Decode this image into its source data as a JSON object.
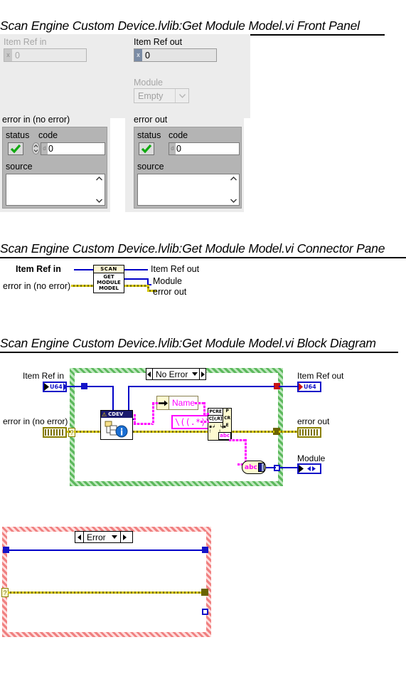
{
  "sections": {
    "front_panel_title": "Scan Engine Custom Device.lvlib:Get Module Model.vi Front Panel",
    "connector_pane_title": "Scan Engine Custom Device.lvlib:Get Module Model.vi Connector Pane",
    "block_diagram_title": "Scan Engine Custom Device.lvlib:Get Module Model.vi Block Diagram"
  },
  "front_panel": {
    "item_ref_in": {
      "label": "Item Ref in",
      "value": "0",
      "type_chip": "x",
      "enabled": false
    },
    "item_ref_out": {
      "label": "Item Ref out",
      "value": "0",
      "type_chip": "x",
      "enabled": true
    },
    "module": {
      "label": "Module",
      "value": "Empty",
      "enabled": false
    },
    "error_in": {
      "label": "error in (no error)",
      "status_label": "status",
      "code_label": "code",
      "code_value": "0",
      "code_chip": "d",
      "source_label": "source",
      "source_value": ""
    },
    "error_out": {
      "label": "error out",
      "status_label": "status",
      "code_label": "code",
      "code_value": "0",
      "code_chip": "d",
      "source_label": "source",
      "source_value": ""
    }
  },
  "connector_pane": {
    "icon": {
      "banner": "SCAN",
      "line1": "GET",
      "line2": "MODULE",
      "line3": "MODEL"
    },
    "inputs": [
      {
        "label": "Item Ref in",
        "bold": true
      },
      {
        "label": "error in (no error)",
        "bold": false
      }
    ],
    "outputs": [
      {
        "label": "Item Ref out"
      },
      {
        "label": "Module"
      },
      {
        "label": "error out"
      }
    ]
  },
  "block_diagram": {
    "case_no_error": {
      "selector": "No Error",
      "terminals": {
        "item_ref_in": {
          "label": "Item Ref in",
          "type": "U64"
        },
        "item_ref_out": {
          "label": "Item Ref out",
          "type": "U64"
        },
        "error_in": {
          "label": "error in (no error)"
        },
        "error_out": {
          "label": "error out"
        },
        "module": {
          "label": "Module"
        }
      },
      "nodes": {
        "cdev_property": {
          "class": "CDEV",
          "kind": "property-node"
        },
        "name_property": {
          "label": "Name"
        },
        "regex_constant": {
          "value": "\\((.*)\\)"
        },
        "pcre_match": {
          "line1": "PCRE",
          "line2": "C[r,R]",
          "side": "PCRE",
          "out": "abc"
        },
        "scan_from_string": {
          "label": "abc"
        }
      }
    },
    "case_error": {
      "selector": "Error"
    }
  },
  "colors": {
    "panel_bg": "#ececec",
    "cluster_bg": "#b4b4b4",
    "wire_blue": "#0000c8",
    "wire_error": "#7a7000",
    "wire_magenta": "#ff00ff",
    "case_green": "#5cb85c",
    "case_red": "#f08080"
  }
}
